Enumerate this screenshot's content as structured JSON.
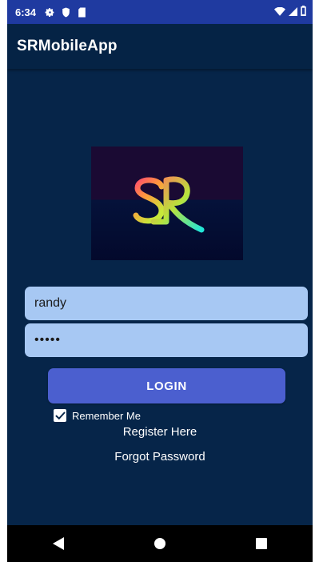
{
  "status_bar": {
    "time": "6:34",
    "left_icons": [
      "gear-icon",
      "shield-icon",
      "sd-card-icon"
    ],
    "right_icons": [
      "wifi-icon",
      "signal-icon",
      "battery-icon"
    ]
  },
  "app_bar": {
    "title": "SRMobileApp"
  },
  "logo": {
    "text": "SR"
  },
  "login_form": {
    "username_value": "randy",
    "password_value": "•••••",
    "login_label": "LOGIN",
    "remember_me_label": "Remember Me",
    "remember_me_checked": true
  },
  "links": {
    "register": "Register Here",
    "forgot_password": "Forgot Password"
  },
  "nav_bar": {
    "icons": [
      "back-icon",
      "home-icon",
      "recents-icon"
    ]
  },
  "colors": {
    "background": "#062549",
    "status_bar": "#1f3aa0",
    "field": "#a7c8f3",
    "button": "#4b5fcf"
  }
}
